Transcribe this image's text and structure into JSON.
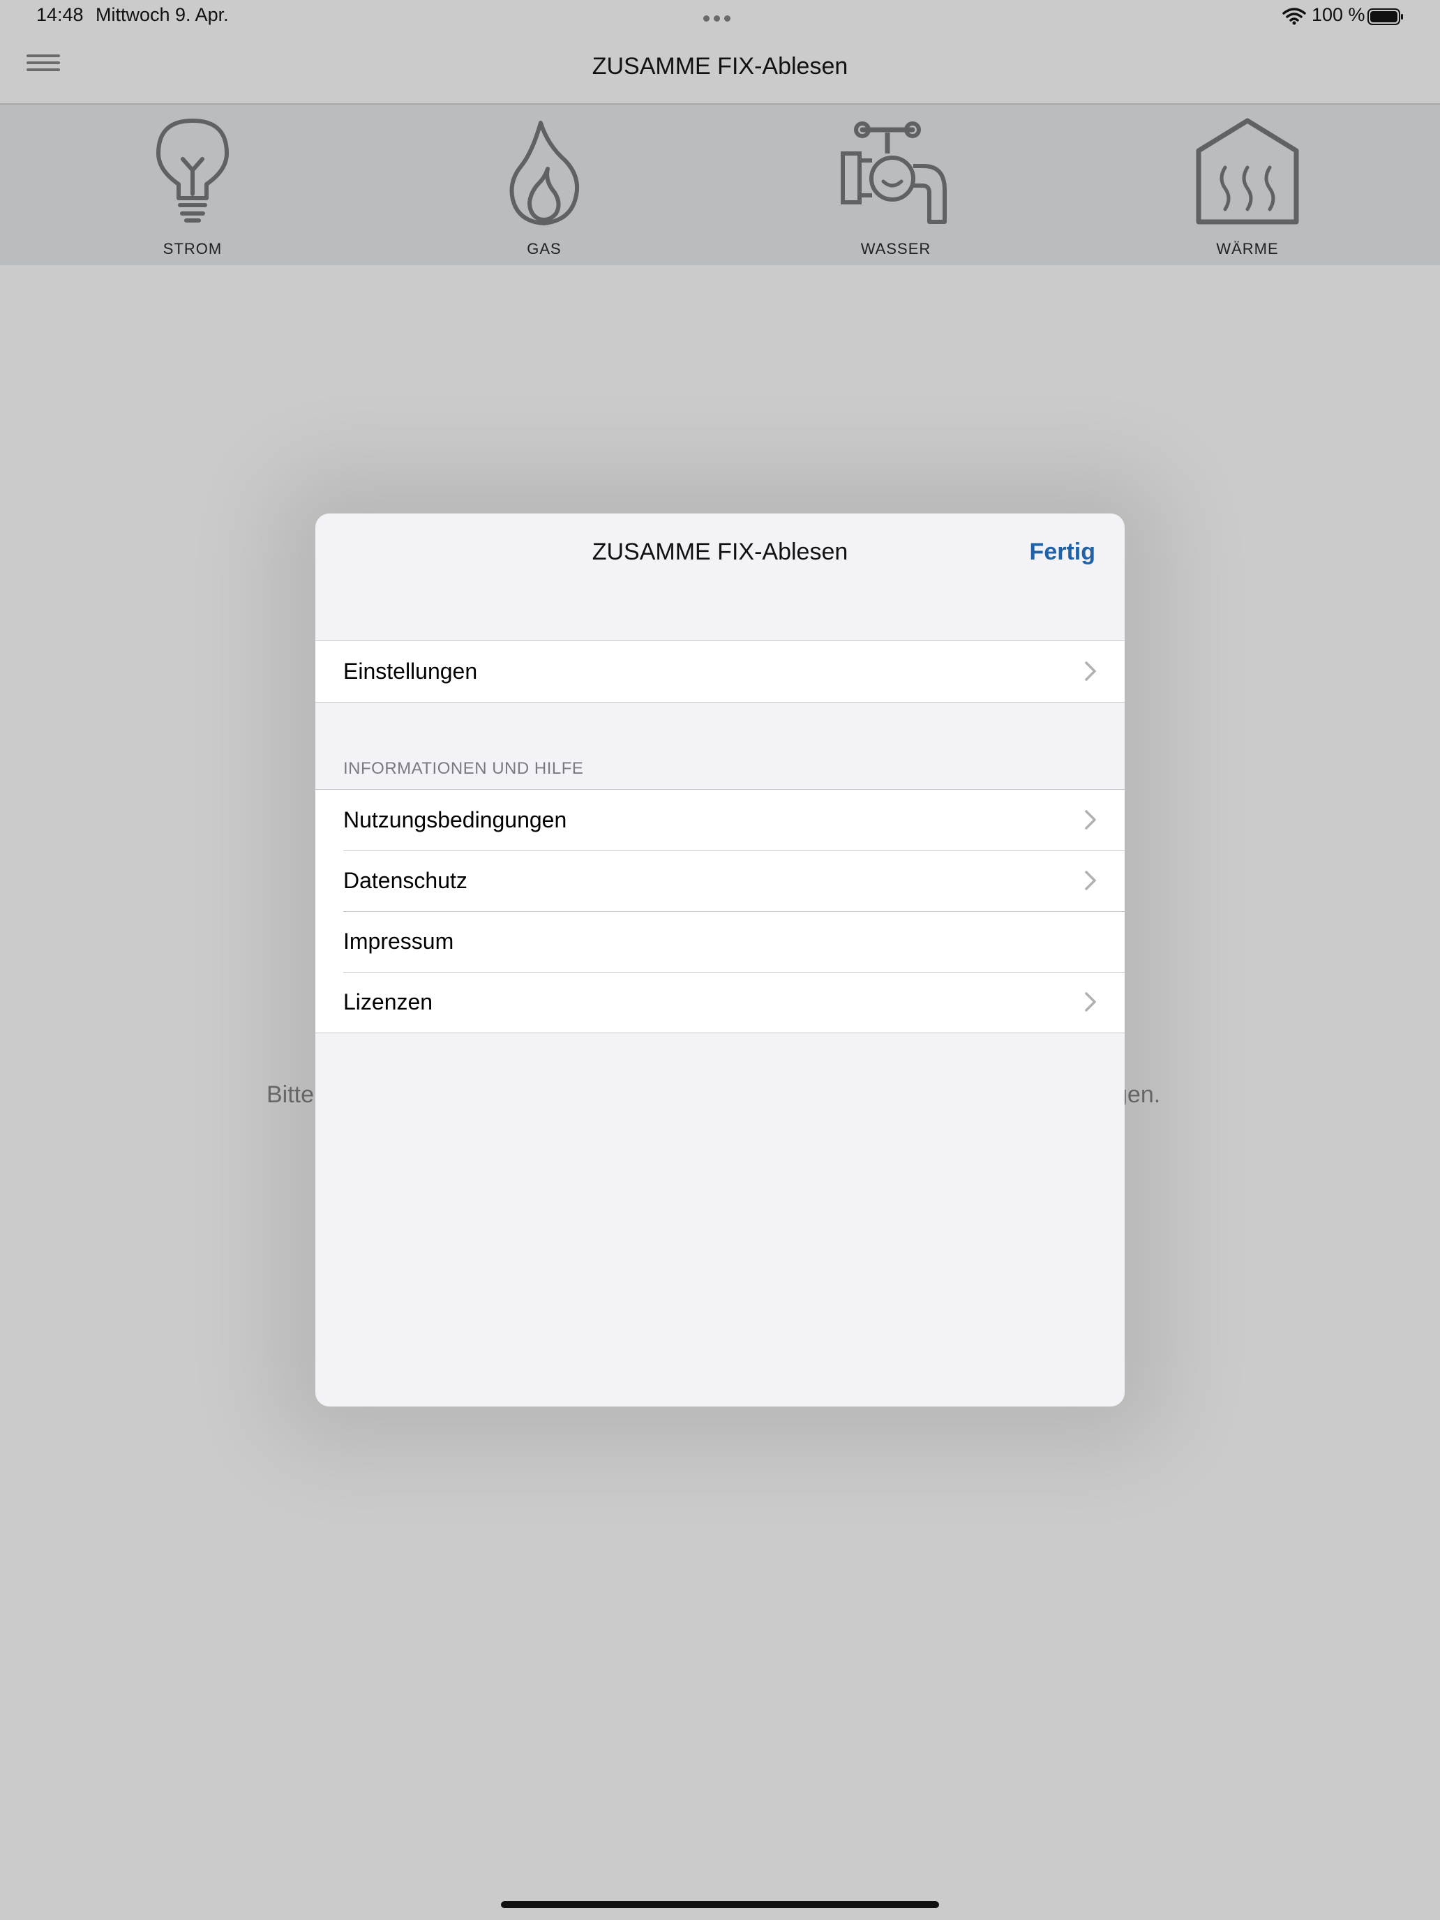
{
  "status_bar": {
    "time": "14:48",
    "date": "Mittwoch 9. Apr.",
    "battery_text": "100 %"
  },
  "nav": {
    "title": "ZUSAMME FIX-Ablesen"
  },
  "categories": [
    {
      "label": "STROM",
      "icon": "light-bulb-icon"
    },
    {
      "label": "GAS",
      "icon": "flame-icon"
    },
    {
      "label": "WASSER",
      "icon": "water-tap-icon"
    },
    {
      "label": "WÄRME",
      "icon": "house-heat-icon"
    }
  ],
  "background_message": {
    "visible_left": "Bitte",
    "visible_right": "gen."
  },
  "modal": {
    "title": "ZUSAMME FIX-Ablesen",
    "done_label": "Fertig",
    "settings_row": "Einstellungen",
    "section_header": "INFORMATIONEN UND HILFE",
    "info_rows": [
      {
        "label": "Nutzungsbedingungen",
        "chevron": true
      },
      {
        "label": "Datenschutz",
        "chevron": true
      },
      {
        "label": "Impressum",
        "chevron": false
      },
      {
        "label": "Lizenzen",
        "chevron": true
      }
    ]
  },
  "colors": {
    "accent": "#1f62a8",
    "icon_stroke": "#5f6163",
    "category_bar": "#b9bdbf",
    "modal_bg": "#f2f2f7"
  }
}
